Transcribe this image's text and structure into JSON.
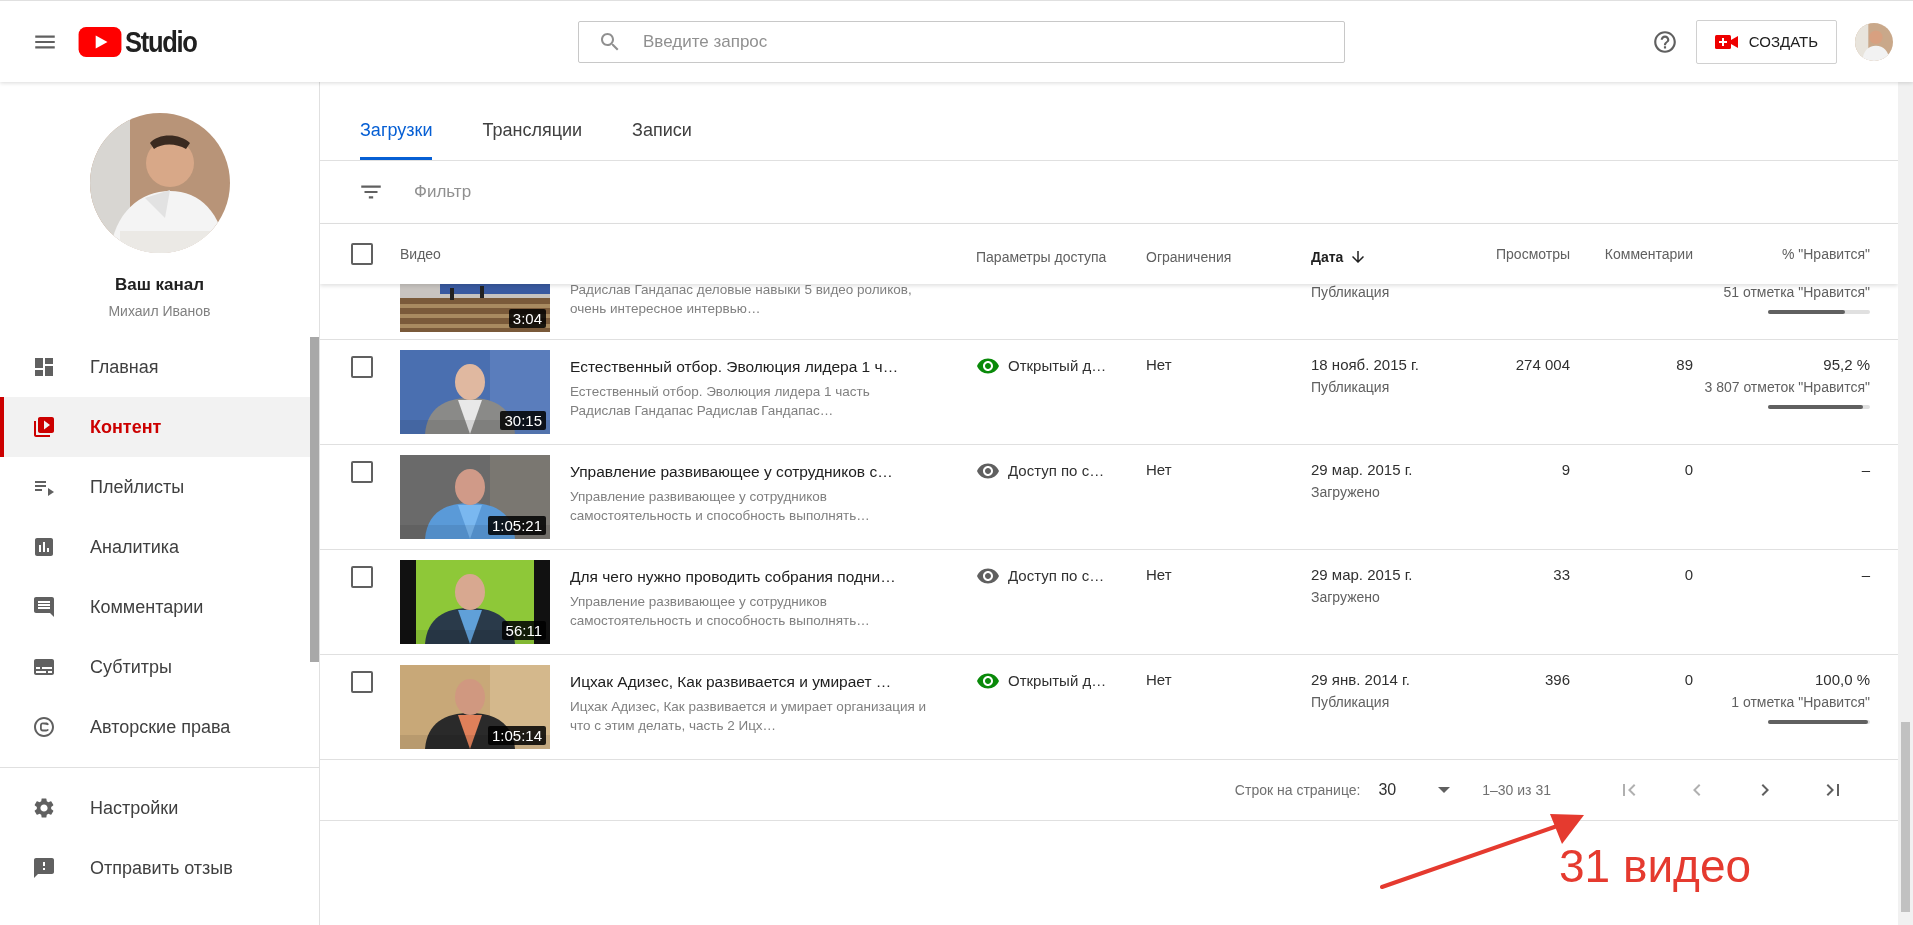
{
  "header": {
    "logo_text": "Studio",
    "search": {
      "placeholder": "Введите запрос"
    },
    "create_button": "СОЗДАТЬ"
  },
  "sidebar": {
    "channel_title": "Ваш канал",
    "channel_name": "Михаил Иванов",
    "items": [
      {
        "label": "Главная",
        "selected": false
      },
      {
        "label": "Контент",
        "selected": true
      },
      {
        "label": "Плейлисты",
        "selected": false
      },
      {
        "label": "Аналитика",
        "selected": false
      },
      {
        "label": "Комментарии",
        "selected": false
      },
      {
        "label": "Субтитры",
        "selected": false
      },
      {
        "label": "Авторские права",
        "selected": false
      }
    ],
    "bottom_items": [
      {
        "label": "Настройки"
      },
      {
        "label": "Отправить отзыв"
      }
    ]
  },
  "tabs": [
    {
      "label": "Загрузки",
      "selected": true
    },
    {
      "label": "Трансляции",
      "selected": false
    },
    {
      "label": "Записи",
      "selected": false
    }
  ],
  "filter": {
    "placeholder": "Фильтр"
  },
  "table": {
    "select_all_checked": false,
    "columns": [
      {
        "label": "Видео",
        "sorted": false
      },
      {
        "label": "Параметры доступа",
        "sorted": false
      },
      {
        "label": "Ограничения",
        "sorted": false
      },
      {
        "label": "Дата",
        "sorted": true
      },
      {
        "label": "Просмотры",
        "sorted": false
      },
      {
        "label": "Комментарии",
        "sorted": false
      },
      {
        "label": "% \"Нравится\"",
        "sorted": false
      }
    ],
    "clipped_row": {
      "description": "Радислав Гандапас деловые навыки 5 видео роликов, очень интересное интервью…",
      "duration": "3:04",
      "date_status": "Публикация",
      "likes_count": "51 отметка \"Нравится\"",
      "level": 0.77
    },
    "rows": [
      {
        "checked": false,
        "title": "Естественный отбор. Эволюция лидера 1 ч…",
        "description": "Естественный отбор. Эволюция лидера 1 часть Радислав Гандапас Радислав Гандапас…",
        "duration": "30:15",
        "public": true,
        "visibility": "Открытый д…",
        "restrictions": "Нет",
        "date": "18 нояб. 2015 г.",
        "date_status": "Публикация",
        "views": "274 004",
        "comments": "89",
        "likes_percent": "95,2 %",
        "likes_count": "3 807 отметок \"Нравится\"",
        "level": 0.95
      },
      {
        "checked": false,
        "title": "Управление развивающее у сотрудников с…",
        "description": "Управление развивающее у сотрудников самостоятельность и способность выполнять…",
        "duration": "1:05:21",
        "public": false,
        "visibility": "Доступ по с…",
        "restrictions": "Нет",
        "date": "29 мар. 2015 г.",
        "date_status": "Загружено",
        "views": "9",
        "comments": "0",
        "likes_percent": "–"
      },
      {
        "checked": false,
        "title": "Для чего нужно проводить собрания подни…",
        "description": "Управление развивающее у сотрудников самостоятельность и способность выполнять…",
        "duration": "56:11",
        "public": false,
        "visibility": "Доступ по с…",
        "restrictions": "Нет",
        "date": "29 мар. 2015 г.",
        "date_status": "Загружено",
        "views": "33",
        "comments": "0",
        "likes_percent": "–"
      },
      {
        "checked": false,
        "title": "Ицхак Адизес, Как развивается и умирает …",
        "description": "Ицхак Адизес, Как развивается и умирает организация и что с этим делать, часть 2 Ицх…",
        "duration": "1:05:14",
        "public": true,
        "visibility": "Открытый д…",
        "restrictions": "Нет",
        "date": "29 янв. 2014 г.",
        "date_status": "Публикация",
        "views": "396",
        "comments": "0",
        "likes_percent": "100,0 %",
        "likes_count": "1 отметка \"Нравится\"",
        "level": 1.0
      }
    ]
  },
  "pagination": {
    "rows_label": "Строк на странице:",
    "rows_value": "30",
    "range": "1–30 из 31",
    "buttons": [
      {
        "disabled": true
      },
      {
        "disabled": true
      },
      {
        "disabled": false
      },
      {
        "disabled": false
      }
    ]
  },
  "annotation": {
    "text": "31 видео"
  }
}
